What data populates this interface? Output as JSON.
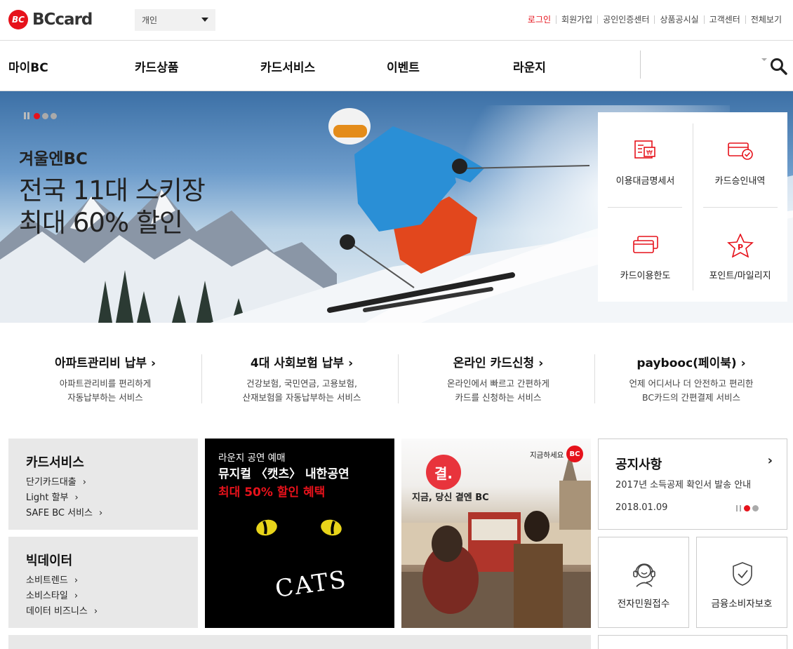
{
  "header": {
    "logo_mark": "BC",
    "logo_text": "BCcard",
    "selector": "개인",
    "util_links": [
      "로그인",
      "회원가입",
      "공인인증센터",
      "상품공시실",
      "고객센터",
      "전체보기"
    ]
  },
  "gnb": {
    "items": [
      "마이BC",
      "카드상품",
      "카드서비스",
      "이벤트",
      "라운지"
    ]
  },
  "hero": {
    "title": "겨울엔BC",
    "line1": "전국 11대 스키장",
    "line2": "최대 60% 할인"
  },
  "quick_menu": [
    {
      "label": "이용대금명세서",
      "icon": "statement-icon"
    },
    {
      "label": "카드승인내역",
      "icon": "card-check-icon"
    },
    {
      "label": "카드이용한도",
      "icon": "card-limit-icon"
    },
    {
      "label": "포인트/마일리지",
      "icon": "point-star-icon"
    }
  ],
  "services": [
    {
      "title": "아파트관리비 납부",
      "desc1": "아파트관리비를 편리하게",
      "desc2": "자동납부하는 서비스"
    },
    {
      "title": "4대 사회보험 납부",
      "desc1": "건강보험, 국민연금, 고용보험,",
      "desc2": "산재보험을 자동납부하는 서비스"
    },
    {
      "title": "온라인 카드신청",
      "desc1": "온라인에서 빠르고 간편하게",
      "desc2": "카드를 신청하는 서비스"
    },
    {
      "title": "paybooc(페이북)",
      "desc1": "언제 어디서나 더 안전하고 편리한",
      "desc2": "BC카드의 간편결제 서비스"
    }
  ],
  "card_service_box": {
    "title": "카드서비스",
    "links": [
      "단기카드대출",
      "Light 할부",
      "SAFE BC 서비스"
    ]
  },
  "bigdata_box": {
    "title": "빅데이터",
    "links": [
      "소비트렌드",
      "소비스타일",
      "데이터 비즈니스"
    ]
  },
  "promo_cats": {
    "line1": "라운지 공연 예매",
    "line2": "뮤지컬 〈캣츠〉 내한공연",
    "line3": "최대 50% 할인 혜택",
    "logo": "CATS"
  },
  "promo_gyeol": {
    "badge": "결.",
    "tagline": "지금, 당신 곁엔 BC",
    "corner": "지금하세요",
    "corner_logo": "BC"
  },
  "notice": {
    "title": "공지사항",
    "headline": "2017년 소득공제 확인서 발송 안내",
    "date": "2018.01.09"
  },
  "shortcuts": [
    {
      "label": "전자민원접수",
      "icon": "headset-icon"
    },
    {
      "label": "금융소비자보호",
      "icon": "shield-check-icon"
    }
  ],
  "colors": {
    "accent": "#e6121b"
  }
}
